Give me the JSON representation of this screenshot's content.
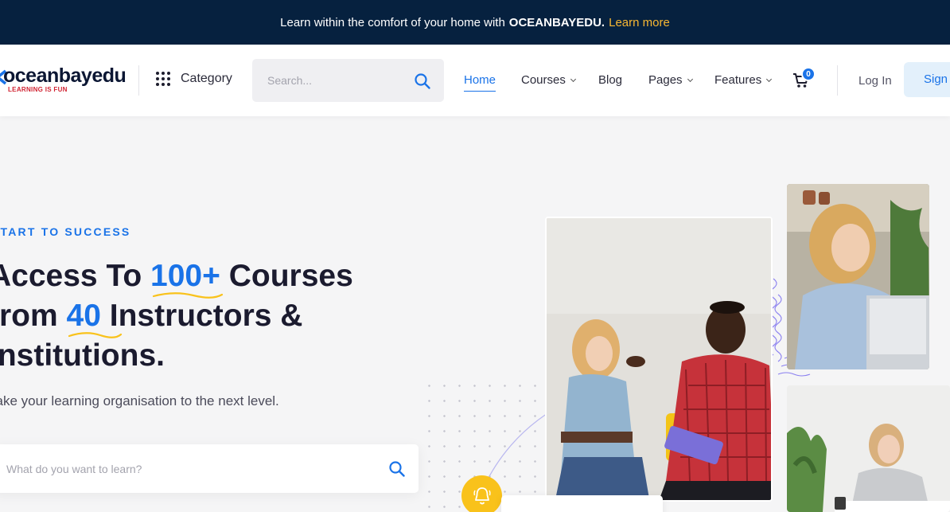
{
  "announcement": {
    "text": "Learn within the comfort of your home with",
    "brand": "OCEANBAYEDU.",
    "link": "Learn more"
  },
  "header": {
    "logo_text": "oceanbayedu",
    "logo_tagline": "LEARNING IS FUN",
    "category_label": "Category",
    "search_placeholder": "Search...",
    "nav": [
      {
        "label": "Home",
        "active": true
      },
      {
        "label": "Courses",
        "dropdown": true
      },
      {
        "label": "Blog"
      },
      {
        "label": "Pages",
        "dropdown": true
      },
      {
        "label": "Features",
        "dropdown": true
      }
    ],
    "cart_count": "0",
    "login_label": "Log In",
    "signup_label": "Sign Up"
  },
  "hero": {
    "kicker": "START TO SUCCESS",
    "headline": {
      "line1_pre": "Access To",
      "line1_highlight": "100+",
      "line1_post": "Courses",
      "line2_pre": "from",
      "line2_highlight": "40",
      "line2_post": "Instructors &",
      "line3": "Institutions."
    },
    "subtext": "Take your learning organisation to the next level.",
    "search_placeholder": "What do you want to learn?"
  },
  "colors": {
    "accent": "#1a73e8",
    "topbar_bg": "#06213f",
    "link_yellow": "#f7b733",
    "bell_yellow": "#f9c21b"
  }
}
